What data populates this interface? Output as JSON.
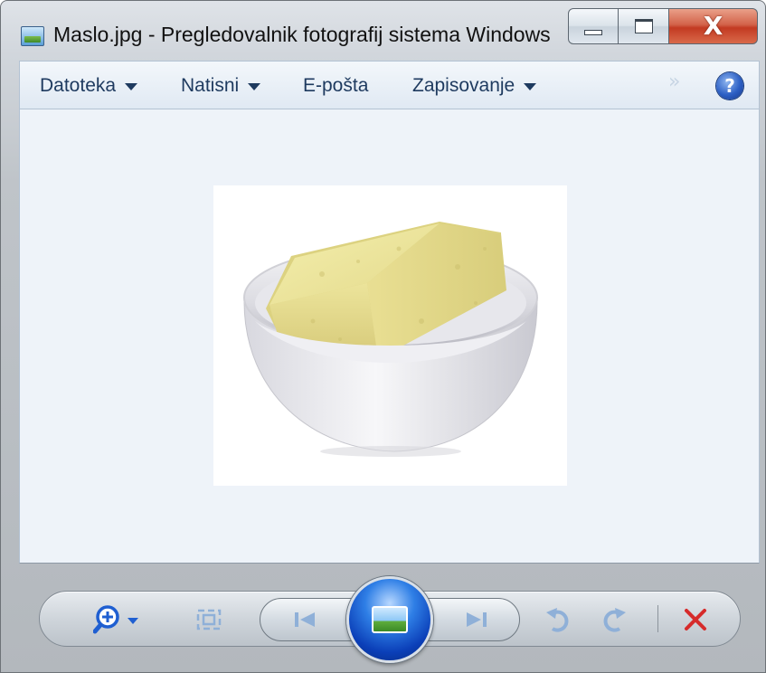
{
  "window": {
    "title": "Maslo.jpg - Pregledovalnik fotografij sistema Windows",
    "app_icon": "photo-viewer-icon",
    "caption": {
      "minimize_icon": "minimize-icon",
      "maximize_icon": "maximize-icon",
      "close_glyph": "X"
    }
  },
  "menu": {
    "items": [
      {
        "label": "Datoteka",
        "dropdown": true
      },
      {
        "label": "Natisni",
        "dropdown": true
      },
      {
        "label": "E-pošta",
        "dropdown": false
      },
      {
        "label": "Zapisovanje",
        "dropdown": true
      }
    ],
    "overflow_glyph": "»",
    "help_glyph": "?"
  },
  "viewer": {
    "image_subject": "butter-in-bowl"
  },
  "toolbar": {
    "icons": {
      "zoom": "zoom-icon",
      "actual_size": "actual-size-icon",
      "previous": "previous-icon",
      "slideshow": "slideshow-icon",
      "next": "next-icon",
      "rotate_ccw": "rotate-counterclockwise-icon",
      "rotate_cw": "rotate-clockwise-icon",
      "delete": "delete-icon"
    },
    "colors": {
      "accent": "#1f5fd1",
      "delete": "#d62b2b",
      "disabled": "#8fb0d8"
    }
  }
}
